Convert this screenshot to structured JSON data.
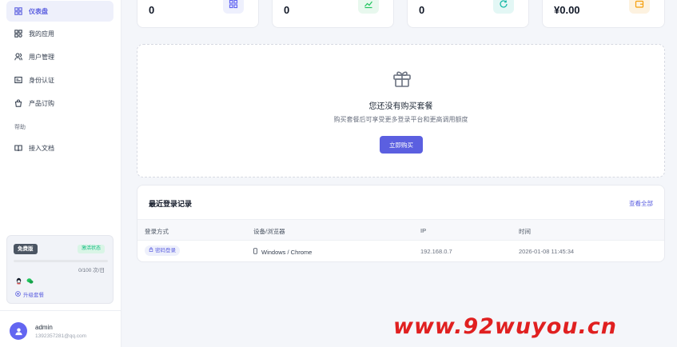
{
  "sidebar": {
    "items": [
      {
        "label": "仪表盘",
        "icon": "dashboard-icon",
        "active": true
      },
      {
        "label": "我的应用",
        "icon": "apps-icon",
        "active": false
      },
      {
        "label": "用户管理",
        "icon": "users-icon",
        "active": false
      },
      {
        "label": "身份认证",
        "icon": "id-card-icon",
        "active": false
      },
      {
        "label": "产品订购",
        "icon": "shopping-bag-icon",
        "active": false
      }
    ],
    "help_label": "帮助",
    "help_items": [
      {
        "label": "接入文档",
        "icon": "book-icon"
      }
    ]
  },
  "plan": {
    "name": "免费版",
    "status": "激活状态",
    "usage": "0/100 次/日",
    "usage_fraction": 0,
    "upgrade_label": "升级套餐"
  },
  "user": {
    "name": "admin",
    "email": "1392357281@qq.com"
  },
  "stats": [
    {
      "value": "0",
      "icon": "apps-icon",
      "color": "#6366f1",
      "bg": "#eef0fd"
    },
    {
      "value": "0",
      "icon": "chart-icon",
      "color": "#22c55e",
      "bg": "#e8f8ee"
    },
    {
      "value": "0",
      "icon": "refresh-icon",
      "color": "#14b8a6",
      "bg": "#e3f7f5"
    },
    {
      "value": "¥0.00",
      "icon": "wallet-icon",
      "color": "#f59e0b",
      "bg": "#fdf2e0"
    }
  ],
  "empty_state": {
    "title": "您还没有购买套餐",
    "subtitle": "购买套餐后可享受更多登录平台和更高调用额度",
    "button": "立即购买"
  },
  "login_records": {
    "title": "最近登录记录",
    "view_all": "查看全部",
    "columns": [
      "登录方式",
      "设备/浏览器",
      "IP",
      "时间"
    ],
    "rows": [
      {
        "method": "密码登录",
        "device": "Windows / Chrome",
        "ip": "192.168.0.7",
        "time": "2026-01-08 11:45:34"
      }
    ]
  },
  "watermark": "www.92wuyou.cn",
  "colors": {
    "accent": "#5b5fe0",
    "success": "#10b981",
    "watermark": "#e02020"
  }
}
